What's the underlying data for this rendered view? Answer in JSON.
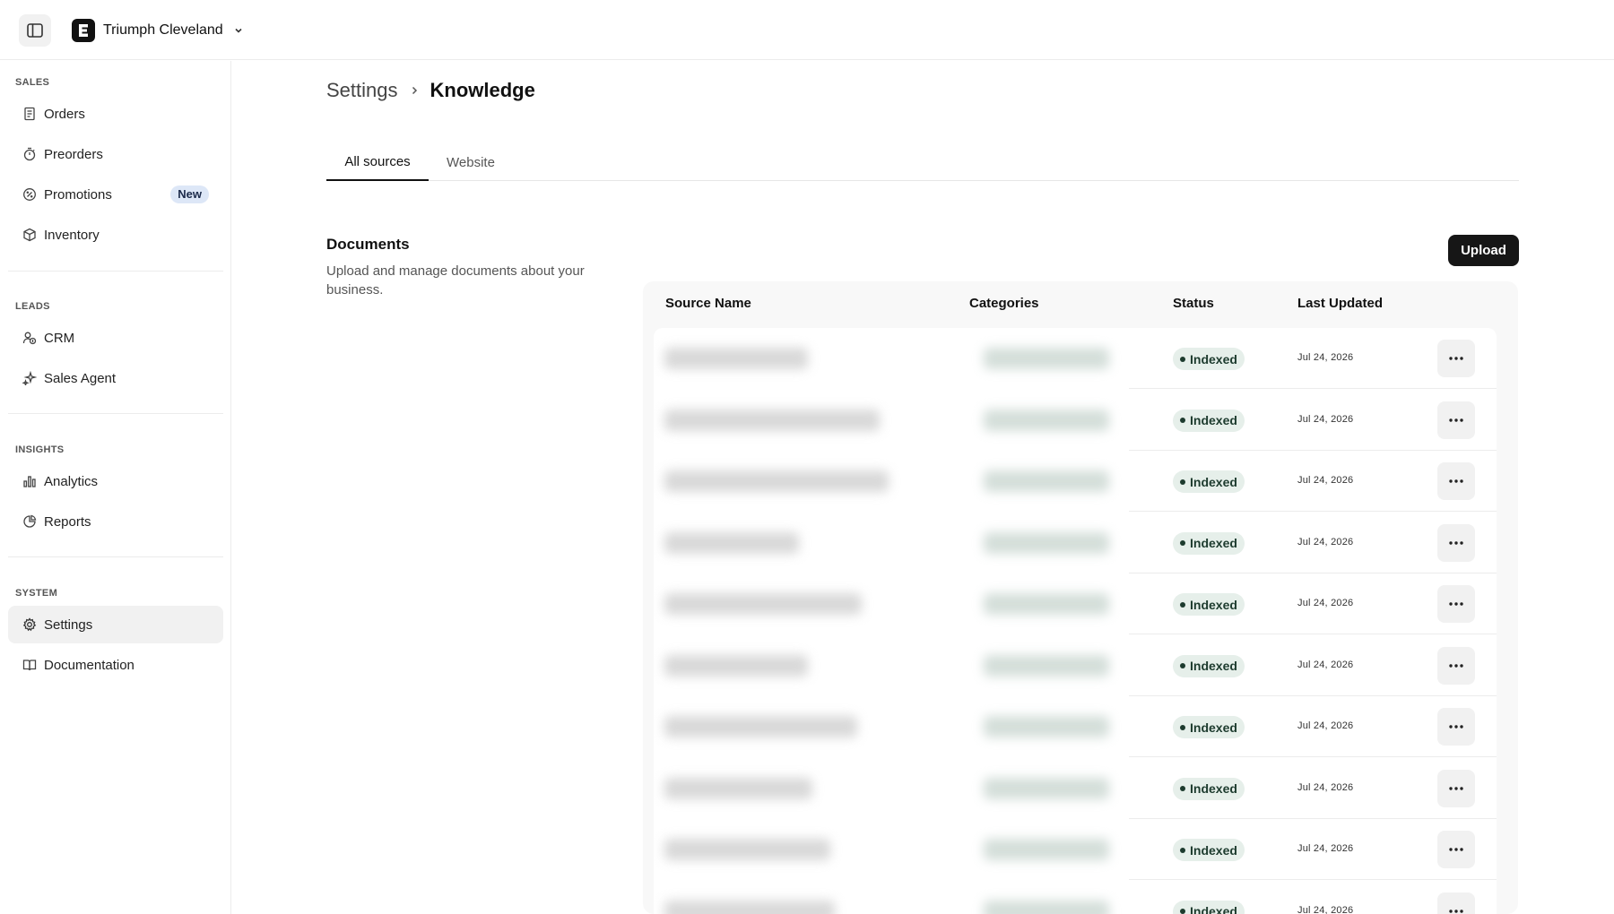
{
  "org": {
    "name": "Triumph Cleveland",
    "logo_letter": "E"
  },
  "icons": {
    "sidebar_toggle": "sidebar-panel-icon",
    "org_switch": "chevron-down-icon",
    "breadcrumb_separator": "chevron-right-icon",
    "row_menu": "more-horizontal-icon"
  },
  "sidebar": {
    "sections": [
      {
        "label": "SALES",
        "items": [
          {
            "label": "Orders",
            "icon": "receipt-icon"
          },
          {
            "label": "Preorders",
            "icon": "timer-icon"
          },
          {
            "label": "Promotions",
            "icon": "badge-percent-icon",
            "badge": "New"
          },
          {
            "label": "Inventory",
            "icon": "package-icon"
          }
        ]
      },
      {
        "label": "LEADS",
        "items": [
          {
            "label": "CRM",
            "icon": "users-icon"
          },
          {
            "label": "Sales Agent",
            "icon": "sparkles-icon"
          }
        ]
      },
      {
        "label": "INSIGHTS",
        "items": [
          {
            "label": "Analytics",
            "icon": "bar-chart-icon"
          },
          {
            "label": "Reports",
            "icon": "pie-chart-icon"
          }
        ]
      },
      {
        "label": "SYSTEM",
        "items": [
          {
            "label": "Settings",
            "icon": "gear-icon",
            "active": true
          },
          {
            "label": "Documentation",
            "icon": "book-icon"
          }
        ]
      }
    ]
  },
  "breadcrumb": {
    "root": "Settings",
    "current": "Knowledge"
  },
  "tabs": [
    {
      "label": "All sources",
      "active": true
    },
    {
      "label": "Website",
      "active": false
    }
  ],
  "documents": {
    "title": "Documents",
    "description": "Upload and manage documents about your business.",
    "upload_label": "Upload",
    "columns": [
      "Source Name",
      "Categories",
      "Status",
      "Last Updated"
    ],
    "rows": [
      {
        "status": "Indexed",
        "date": "Jul 24, 2026"
      },
      {
        "status": "Indexed",
        "date": "Jul 24, 2026"
      },
      {
        "status": "Indexed",
        "date": "Jul 24, 2026"
      },
      {
        "status": "Indexed",
        "date": "Jul 24, 2026"
      },
      {
        "status": "Indexed",
        "date": "Jul 24, 2026"
      },
      {
        "status": "Indexed",
        "date": "Jul 24, 2026"
      },
      {
        "status": "Indexed",
        "date": "Jul 24, 2026"
      },
      {
        "status": "Indexed",
        "date": "Jul 24, 2026"
      },
      {
        "status": "Indexed",
        "date": "Jul 24, 2026"
      },
      {
        "status": "Indexed",
        "date": "Jul 24, 2026"
      }
    ]
  },
  "colors": {
    "accent": "#161616",
    "status_bg": "#e6efea",
    "status_text": "#1d3b2e",
    "badge_bg": "#dde7f7"
  }
}
